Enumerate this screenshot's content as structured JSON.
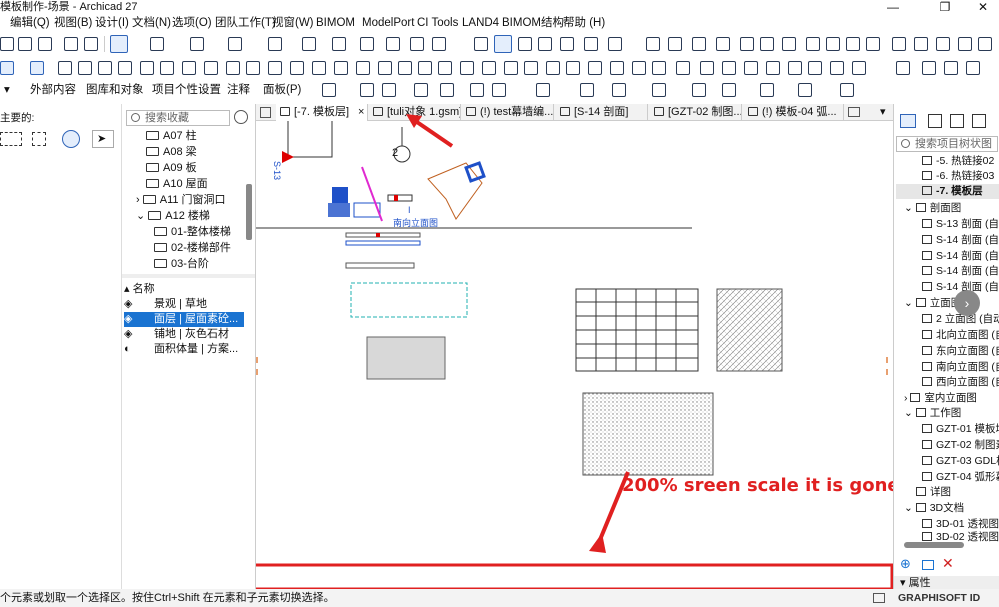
{
  "title_bar": {
    "title": "模板制作-场景 - Archicad 27",
    "min": "—",
    "max": "❐",
    "close": "✕"
  },
  "menu": [
    "编辑(Q)",
    "视图(B)",
    "设计(I)",
    "文档(N)",
    "选项(O)",
    "团队工作(T)",
    "视窗(W)",
    "BIMOM",
    "ModelPort",
    "CI Tools",
    "LAND4",
    "BIMOM结构",
    "帮助 (H)"
  ],
  "toolbar3": {
    "items": [
      "外部内容",
      "图库和对象",
      "项目个性设置",
      "注释",
      "面板(P)"
    ]
  },
  "left_strip": {
    "label": "主要的:"
  },
  "navigator": {
    "search_placeholder": "搜索收藏",
    "folders": [
      "A07 柱",
      "A08 梁",
      "A09 板",
      "A10 屋面",
      "A11 门窗洞口",
      "A12 楼梯",
      "01-整体楼梯",
      "02-楼梯部件",
      "03-台阶"
    ],
    "list_header": "名称",
    "list": [
      "景观 | 草地",
      "面层 | 屋面素砼...",
      "铺地 | 灰色石材",
      "面积体量 | 方案..."
    ],
    "selected_index": 1
  },
  "tabs": [
    {
      "label": "[-7. 模板层]",
      "close": "×"
    },
    {
      "label": "[tuli对象 1.gsm]"
    },
    {
      "label": "(!) test幕墙编..."
    },
    {
      "label": "[S-14 剖面]"
    },
    {
      "label": "[GZT-02 制图..."
    },
    {
      "label": "(!) 模板-04 弧..."
    }
  ],
  "canvas": {
    "marker_label": "2",
    "section_label": "S-13",
    "elevation_label": "南向立面图",
    "annotation": "200% sreen scale it is gone."
  },
  "right_panel": {
    "search_placeholder": "搜索项目树状图",
    "items": [
      {
        "label": "-5. 热链接02",
        "level": 2
      },
      {
        "label": "-6. 热链接03",
        "level": 2
      },
      {
        "label": "-7. 模板层",
        "level": 2,
        "bold": true
      },
      {
        "label": "剖面图",
        "level": 1
      },
      {
        "label": "S-13 剖面 (自动",
        "level": 2
      },
      {
        "label": "S-14 剖面 (自动",
        "level": 2
      },
      {
        "label": "S-14 剖面 (自动",
        "level": 2
      },
      {
        "label": "S-14 剖面 (自动",
        "level": 2
      },
      {
        "label": "S-14 剖面 (自动",
        "level": 2
      },
      {
        "label": "立面图",
        "level": 1
      },
      {
        "label": "2 立面图 (自动)",
        "level": 2
      },
      {
        "label": "北向立面图 (自",
        "level": 2
      },
      {
        "label": "东向立面图 (自",
        "level": 2
      },
      {
        "label": "南向立面图 (自",
        "level": 2
      },
      {
        "label": "西向立面图 (自",
        "level": 2
      },
      {
        "label": "室内立面图",
        "level": 1
      },
      {
        "label": "工作图",
        "level": 1
      },
      {
        "label": "GZT-01 模板填",
        "level": 2
      },
      {
        "label": "GZT-02 制图素",
        "level": 2
      },
      {
        "label": "GZT-03 GDL柱",
        "level": 2
      },
      {
        "label": "GZT-04 弧形幕",
        "level": 2
      },
      {
        "label": "详图",
        "level": 1
      },
      {
        "label": "3D文档",
        "level": 1
      },
      {
        "label": "3D-01 透视图 (",
        "level": 2
      },
      {
        "label": "3D-02 透视图 (",
        "level": 2
      }
    ],
    "properties_label": "属性"
  },
  "status_bar": {
    "text": "个元素或划取一个选择区。按住Ctrl+Shift 在元素和子元素切换选择。",
    "brand": "GRAPHISOFT ID"
  },
  "colors": {
    "annotation_red": "#e02020",
    "selection_blue": "#1a73d1"
  }
}
